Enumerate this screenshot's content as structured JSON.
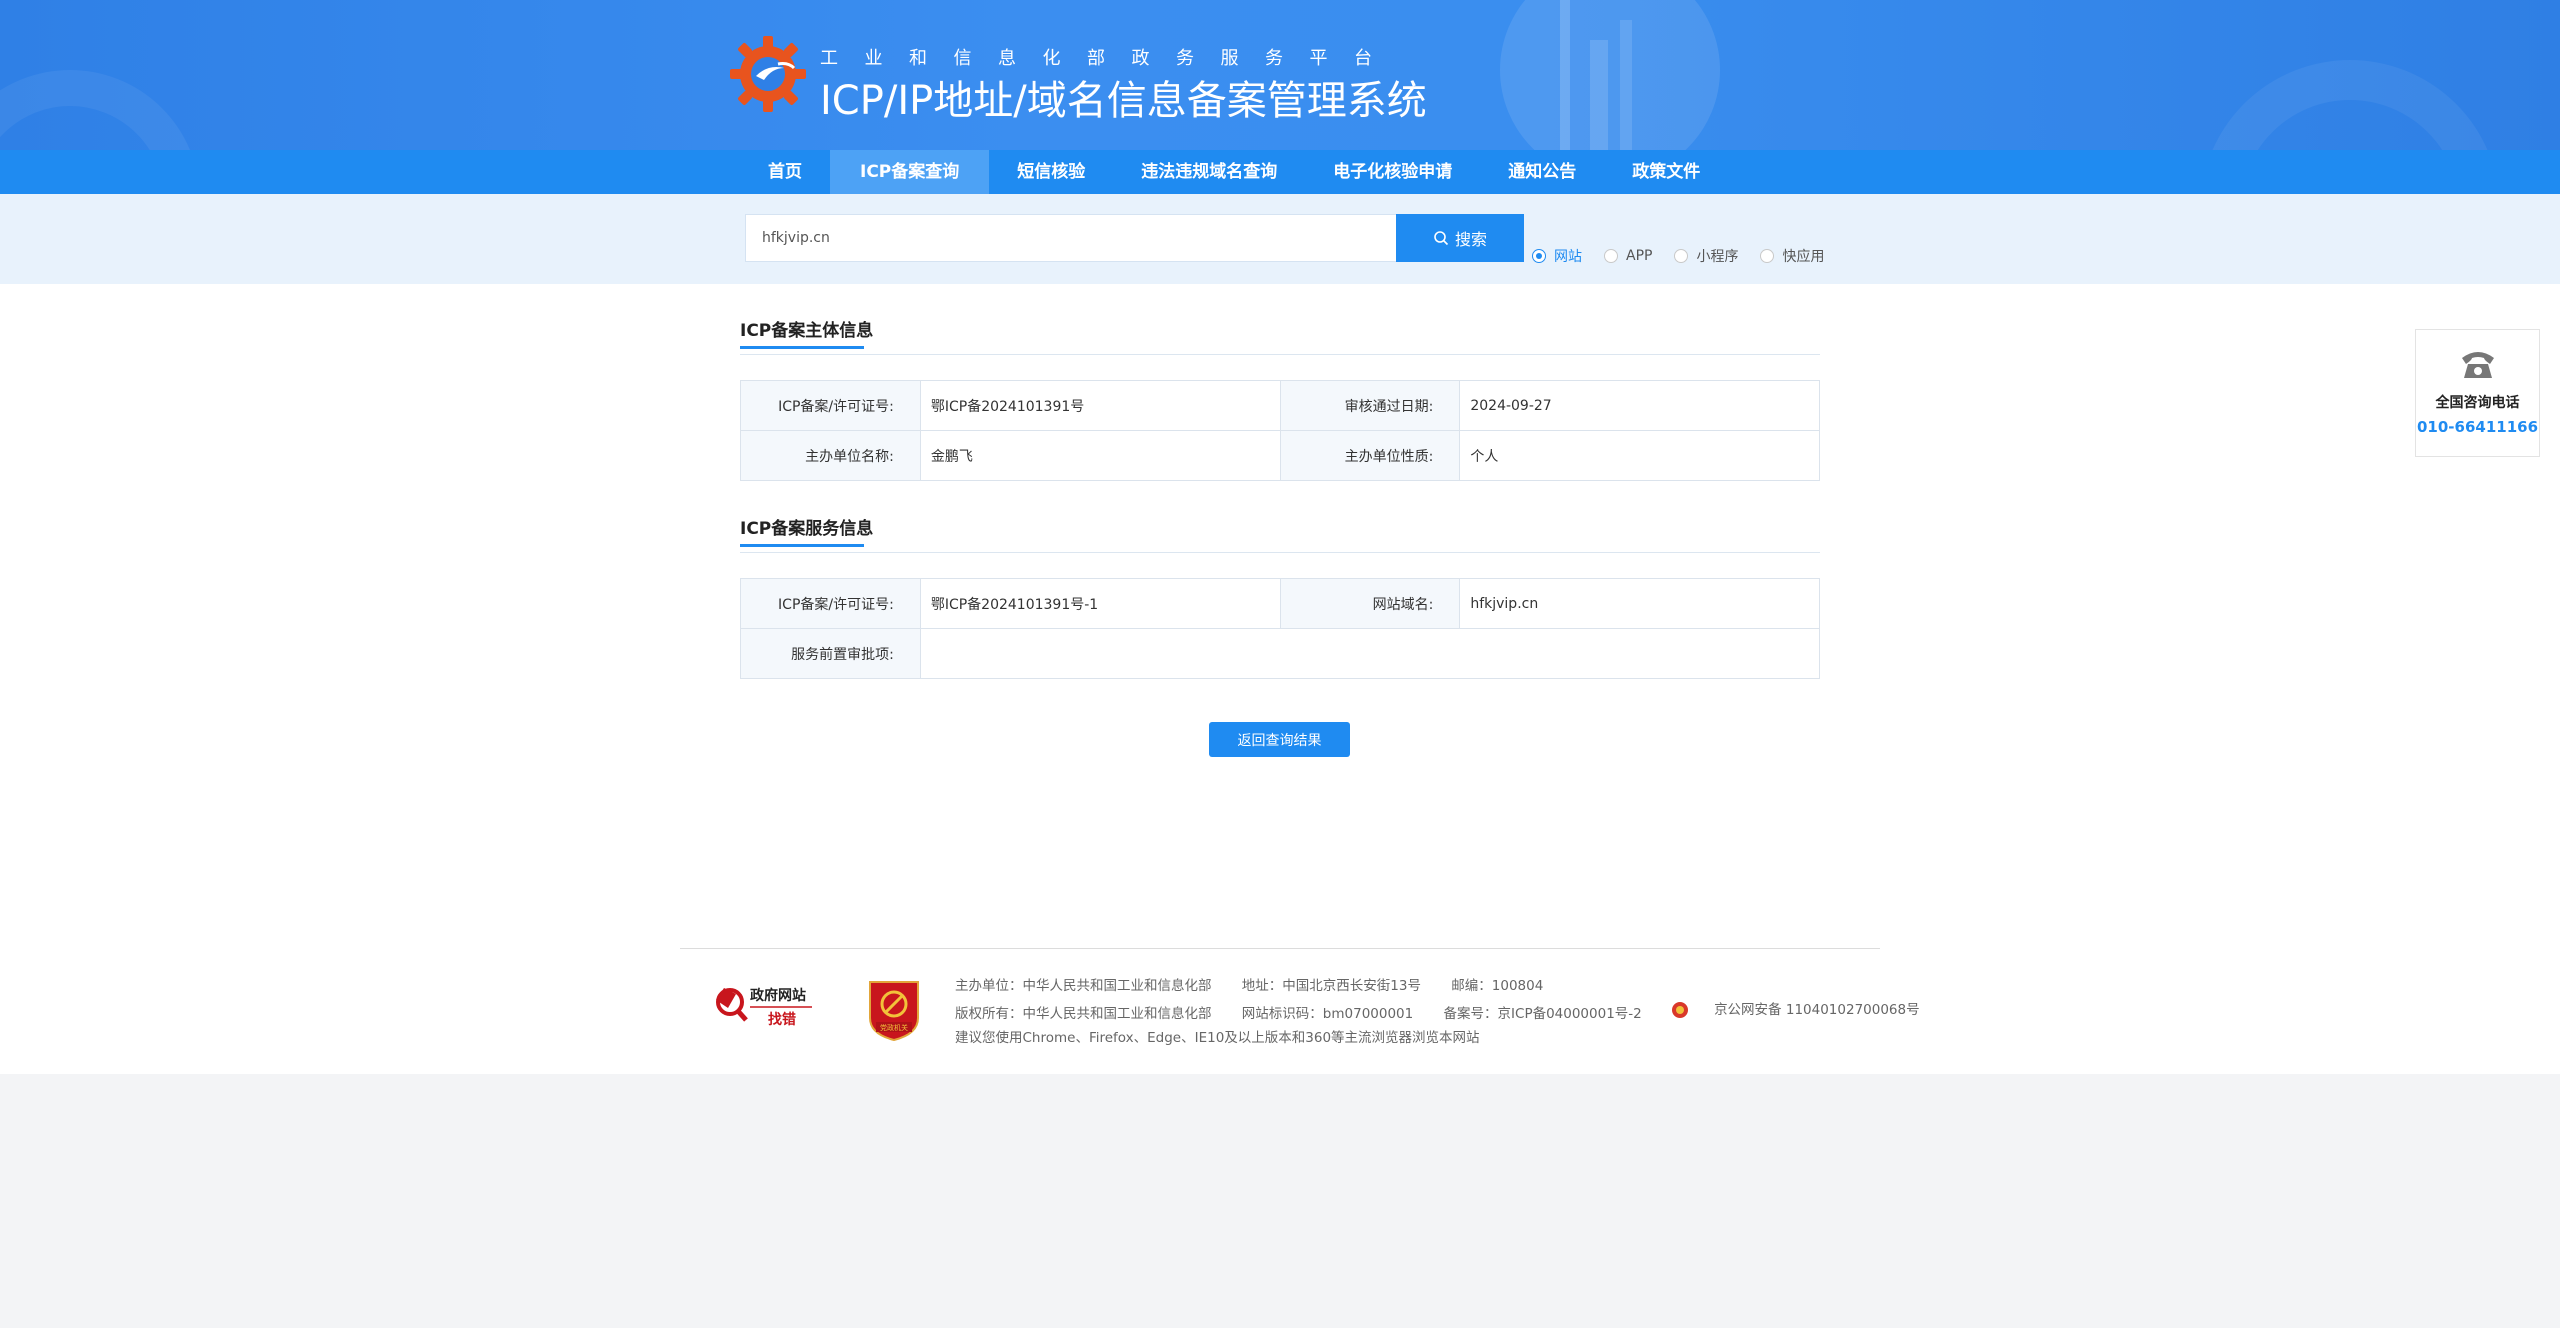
{
  "header": {
    "subtitle": "工业和信息化部政务服务平台",
    "title": "ICP/IP地址/域名信息备案管理系统"
  },
  "nav": {
    "items": [
      {
        "label": "首页"
      },
      {
        "label": "ICP备案查询"
      },
      {
        "label": "短信核验"
      },
      {
        "label": "违法违规域名查询"
      },
      {
        "label": "电子化核验申请"
      },
      {
        "label": "通知公告"
      },
      {
        "label": "政策文件"
      }
    ],
    "active_index": 1
  },
  "search": {
    "value": "hfkjvip.cn",
    "button_label": "搜索",
    "options": [
      {
        "label": "网站",
        "checked": true
      },
      {
        "label": "APP",
        "checked": false
      },
      {
        "label": "小程序",
        "checked": false
      },
      {
        "label": "快应用",
        "checked": false
      }
    ]
  },
  "subject_section": {
    "title": "ICP备案主体信息",
    "rows": [
      {
        "k1": "ICP备案/许可证号:",
        "v1": "鄂ICP备2024101391号",
        "k2": "审核通过日期:",
        "v2": "2024-09-27"
      },
      {
        "k1": "主办单位名称:",
        "v1": "金鹏飞",
        "k2": "主办单位性质:",
        "v2": "个人"
      }
    ]
  },
  "service_section": {
    "title": "ICP备案服务信息",
    "rows": [
      {
        "k1": "ICP备案/许可证号:",
        "v1": "鄂ICP备2024101391号-1",
        "k2": "网站域名:",
        "v2": "hfkjvip.cn"
      },
      {
        "k1": "服务前置审批项:",
        "v1": ""
      }
    ]
  },
  "back_button_label": "返回查询结果",
  "consult": {
    "label": "全国咨询电话",
    "number": "010-66411166"
  },
  "footer": {
    "badges": [
      "政府网站",
      "找错"
    ],
    "dang_badge": "党政机关",
    "row1": [
      "主办单位：中华人民共和国工业和信息化部",
      "地址：中国北京西长安街13号",
      "邮编：100804"
    ],
    "row2": [
      "版权所有：中华人民共和国工业和信息化部",
      "网站标识码：bm07000001",
      "备案号：京ICP备04000001号-2"
    ],
    "police": "京公网安备 11040102700068号",
    "row3": "建议您使用Chrome、Firefox、Edge、IE10及以上版本和360等主流浏览器浏览本网站"
  },
  "colors": {
    "primary": "#1f8bf1",
    "banner": "#3a8eef",
    "nav_active": "#4da2f5"
  }
}
